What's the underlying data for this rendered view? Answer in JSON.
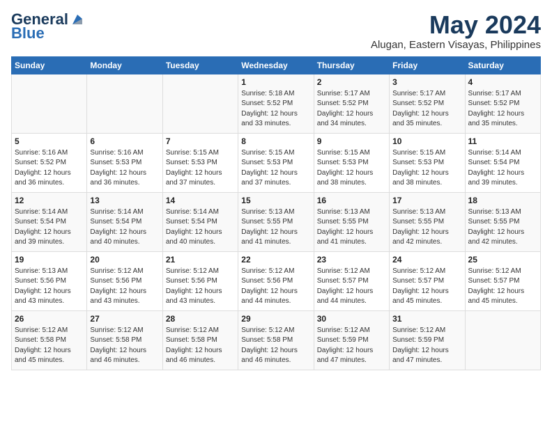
{
  "logo": {
    "general": "General",
    "blue": "Blue"
  },
  "title": {
    "month_year": "May 2024",
    "location": "Alugan, Eastern Visayas, Philippines"
  },
  "headers": [
    "Sunday",
    "Monday",
    "Tuesday",
    "Wednesday",
    "Thursday",
    "Friday",
    "Saturday"
  ],
  "weeks": [
    [
      {
        "day": "",
        "info": ""
      },
      {
        "day": "",
        "info": ""
      },
      {
        "day": "",
        "info": ""
      },
      {
        "day": "1",
        "info": "Sunrise: 5:18 AM\nSunset: 5:52 PM\nDaylight: 12 hours\nand 33 minutes."
      },
      {
        "day": "2",
        "info": "Sunrise: 5:17 AM\nSunset: 5:52 PM\nDaylight: 12 hours\nand 34 minutes."
      },
      {
        "day": "3",
        "info": "Sunrise: 5:17 AM\nSunset: 5:52 PM\nDaylight: 12 hours\nand 35 minutes."
      },
      {
        "day": "4",
        "info": "Sunrise: 5:17 AM\nSunset: 5:52 PM\nDaylight: 12 hours\nand 35 minutes."
      }
    ],
    [
      {
        "day": "5",
        "info": "Sunrise: 5:16 AM\nSunset: 5:52 PM\nDaylight: 12 hours\nand 36 minutes."
      },
      {
        "day": "6",
        "info": "Sunrise: 5:16 AM\nSunset: 5:53 PM\nDaylight: 12 hours\nand 36 minutes."
      },
      {
        "day": "7",
        "info": "Sunrise: 5:15 AM\nSunset: 5:53 PM\nDaylight: 12 hours\nand 37 minutes."
      },
      {
        "day": "8",
        "info": "Sunrise: 5:15 AM\nSunset: 5:53 PM\nDaylight: 12 hours\nand 37 minutes."
      },
      {
        "day": "9",
        "info": "Sunrise: 5:15 AM\nSunset: 5:53 PM\nDaylight: 12 hours\nand 38 minutes."
      },
      {
        "day": "10",
        "info": "Sunrise: 5:15 AM\nSunset: 5:53 PM\nDaylight: 12 hours\nand 38 minutes."
      },
      {
        "day": "11",
        "info": "Sunrise: 5:14 AM\nSunset: 5:54 PM\nDaylight: 12 hours\nand 39 minutes."
      }
    ],
    [
      {
        "day": "12",
        "info": "Sunrise: 5:14 AM\nSunset: 5:54 PM\nDaylight: 12 hours\nand 39 minutes."
      },
      {
        "day": "13",
        "info": "Sunrise: 5:14 AM\nSunset: 5:54 PM\nDaylight: 12 hours\nand 40 minutes."
      },
      {
        "day": "14",
        "info": "Sunrise: 5:14 AM\nSunset: 5:54 PM\nDaylight: 12 hours\nand 40 minutes."
      },
      {
        "day": "15",
        "info": "Sunrise: 5:13 AM\nSunset: 5:55 PM\nDaylight: 12 hours\nand 41 minutes."
      },
      {
        "day": "16",
        "info": "Sunrise: 5:13 AM\nSunset: 5:55 PM\nDaylight: 12 hours\nand 41 minutes."
      },
      {
        "day": "17",
        "info": "Sunrise: 5:13 AM\nSunset: 5:55 PM\nDaylight: 12 hours\nand 42 minutes."
      },
      {
        "day": "18",
        "info": "Sunrise: 5:13 AM\nSunset: 5:55 PM\nDaylight: 12 hours\nand 42 minutes."
      }
    ],
    [
      {
        "day": "19",
        "info": "Sunrise: 5:13 AM\nSunset: 5:56 PM\nDaylight: 12 hours\nand 43 minutes."
      },
      {
        "day": "20",
        "info": "Sunrise: 5:12 AM\nSunset: 5:56 PM\nDaylight: 12 hours\nand 43 minutes."
      },
      {
        "day": "21",
        "info": "Sunrise: 5:12 AM\nSunset: 5:56 PM\nDaylight: 12 hours\nand 43 minutes."
      },
      {
        "day": "22",
        "info": "Sunrise: 5:12 AM\nSunset: 5:56 PM\nDaylight: 12 hours\nand 44 minutes."
      },
      {
        "day": "23",
        "info": "Sunrise: 5:12 AM\nSunset: 5:57 PM\nDaylight: 12 hours\nand 44 minutes."
      },
      {
        "day": "24",
        "info": "Sunrise: 5:12 AM\nSunset: 5:57 PM\nDaylight: 12 hours\nand 45 minutes."
      },
      {
        "day": "25",
        "info": "Sunrise: 5:12 AM\nSunset: 5:57 PM\nDaylight: 12 hours\nand 45 minutes."
      }
    ],
    [
      {
        "day": "26",
        "info": "Sunrise: 5:12 AM\nSunset: 5:58 PM\nDaylight: 12 hours\nand 45 minutes."
      },
      {
        "day": "27",
        "info": "Sunrise: 5:12 AM\nSunset: 5:58 PM\nDaylight: 12 hours\nand 46 minutes."
      },
      {
        "day": "28",
        "info": "Sunrise: 5:12 AM\nSunset: 5:58 PM\nDaylight: 12 hours\nand 46 minutes."
      },
      {
        "day": "29",
        "info": "Sunrise: 5:12 AM\nSunset: 5:58 PM\nDaylight: 12 hours\nand 46 minutes."
      },
      {
        "day": "30",
        "info": "Sunrise: 5:12 AM\nSunset: 5:59 PM\nDaylight: 12 hours\nand 47 minutes."
      },
      {
        "day": "31",
        "info": "Sunrise: 5:12 AM\nSunset: 5:59 PM\nDaylight: 12 hours\nand 47 minutes."
      },
      {
        "day": "",
        "info": ""
      }
    ]
  ]
}
